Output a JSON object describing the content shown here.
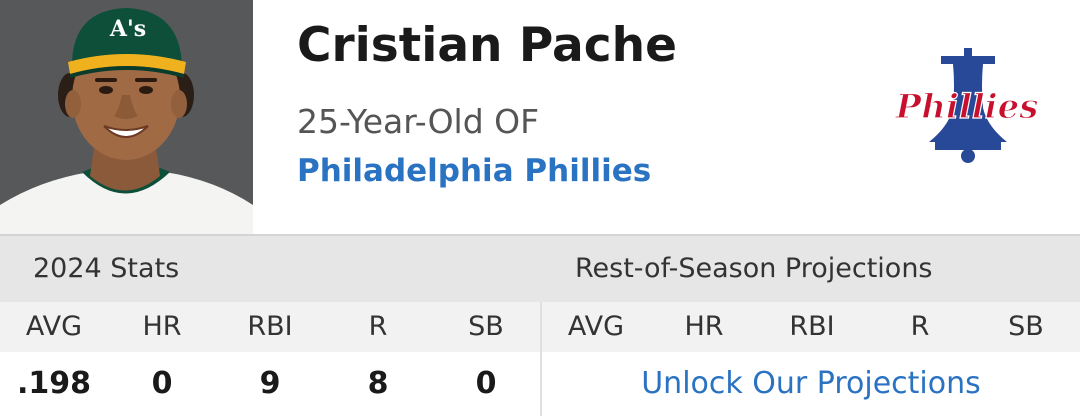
{
  "player": {
    "name": "Cristian Pache",
    "subtitle": "25-Year-Old OF",
    "team": "Philadelphia Phillies",
    "photo_cap_logo_text": "A's",
    "team_logo_text": "Phillies"
  },
  "stats_2024": {
    "title": "2024 Stats",
    "columns": [
      "AVG",
      "HR",
      "RBI",
      "R",
      "SB"
    ],
    "values": [
      ".198",
      "0",
      "9",
      "8",
      "0"
    ]
  },
  "projections": {
    "title": "Rest-of-Season Projections",
    "columns": [
      "AVG",
      "HR",
      "RBI",
      "R",
      "SB"
    ],
    "link_label": "Unlock Our Projections"
  },
  "colors": {
    "link_blue": "#2a72c2",
    "phillies_red": "#c8102e",
    "phillies_blue": "#284898",
    "athletics_green": "#0d4f38",
    "athletics_gold": "#efb21e"
  }
}
